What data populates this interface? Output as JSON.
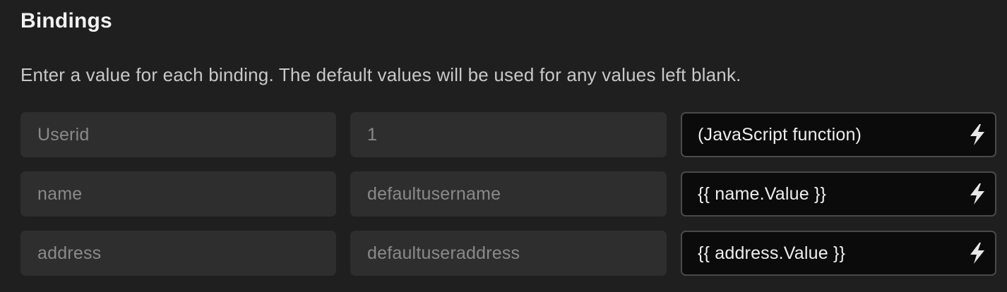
{
  "section": {
    "title": "Bindings",
    "description": "Enter a value for each binding. The default values will be used for any values left blank."
  },
  "bindings": [
    {
      "name": "Userid",
      "default_value": "1",
      "value": "(JavaScript function)"
    },
    {
      "name": "name",
      "default_value": "defaultusername",
      "value": "{{ name.Value }}"
    },
    {
      "name": "address",
      "default_value": "defaultuseraddress",
      "value": "{{ address.Value }}"
    }
  ],
  "icons": {
    "value_action": "lightning-bolt-icon"
  },
  "colors": {
    "background": "#1f1f1f",
    "field_background": "#2e2e2e",
    "value_field_background": "#0b0b0b",
    "value_field_border": "#4a4a4a",
    "placeholder_text": "#8a8a8a"
  }
}
